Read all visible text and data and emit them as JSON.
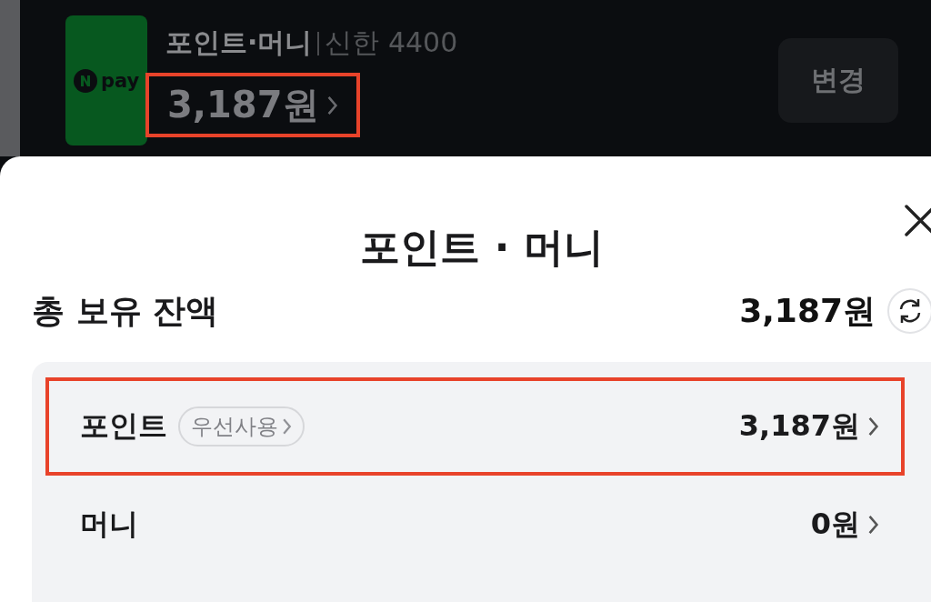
{
  "payment_bar": {
    "logo": "pay",
    "title": "포인트·머니",
    "card": "신한 4400",
    "amount": "3,187원",
    "highlighted": true,
    "change_button": "변경"
  },
  "sheet": {
    "title": "포인트 · 머니",
    "total_label": "총 보유 잔액",
    "total_amount": "3,187원",
    "rows": [
      {
        "label": "포인트",
        "badge": "우선사용",
        "amount": "3,187원",
        "highlighted": true
      },
      {
        "label": "머니",
        "amount": "0원",
        "highlighted": false
      }
    ]
  }
}
